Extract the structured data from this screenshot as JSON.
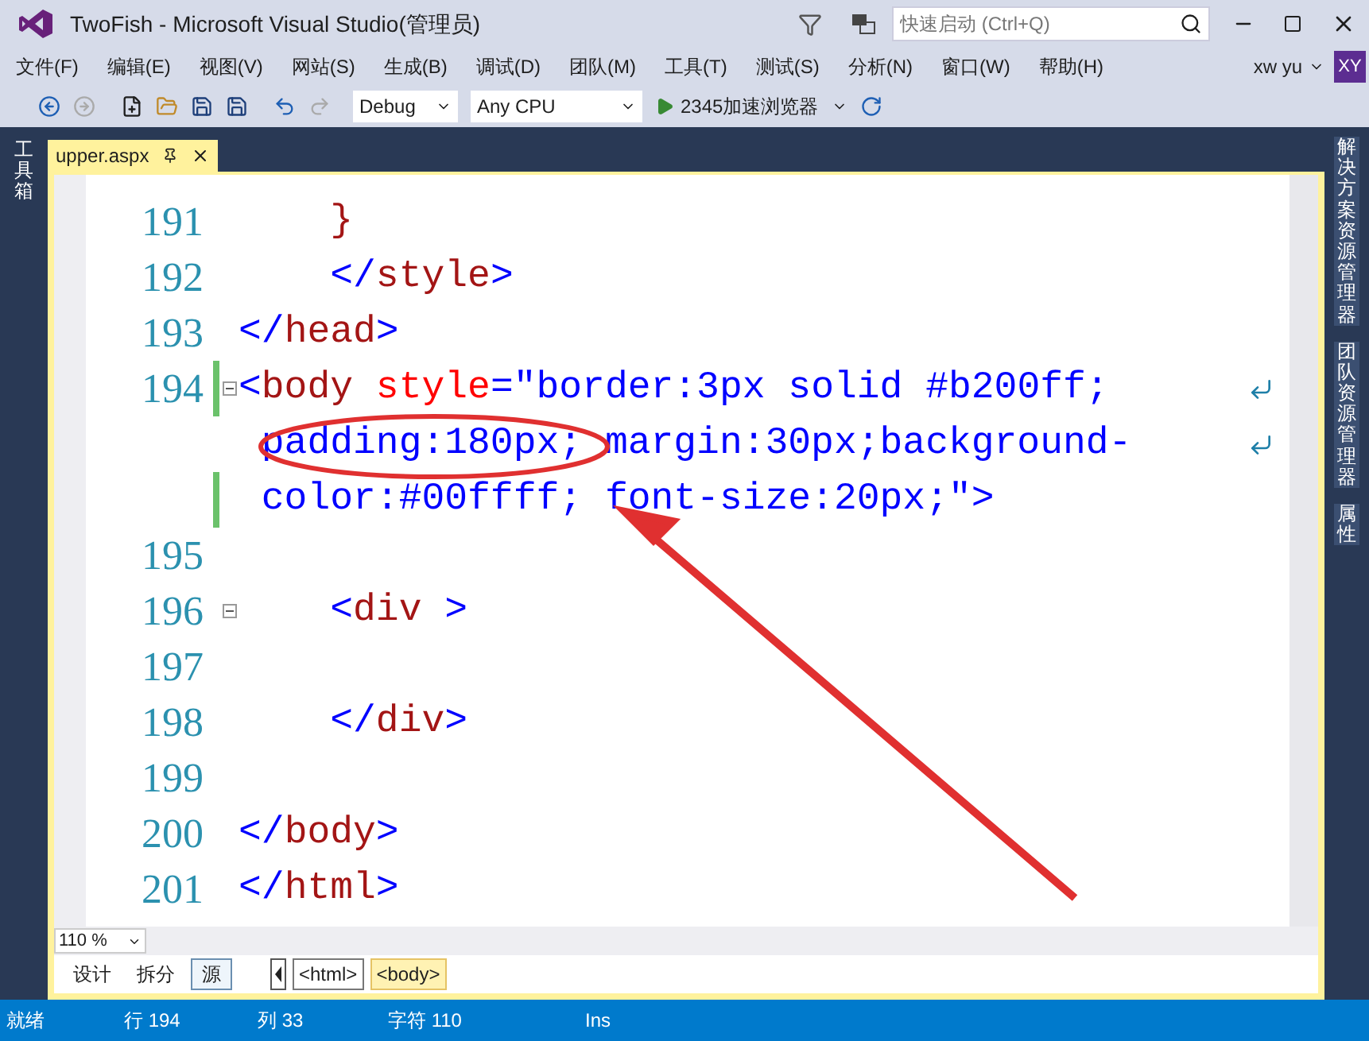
{
  "window": {
    "title": "TwoFish - Microsoft Visual Studio(管理员)",
    "quick_launch": {
      "placeholder": "快速启动 (Ctrl+Q)"
    }
  },
  "menu": [
    "文件(F)",
    "编辑(E)",
    "视图(V)",
    "网站(S)",
    "生成(B)",
    "调试(D)",
    "团队(M)",
    "工具(T)",
    "测试(S)",
    "分析(N)",
    "窗口(W)",
    "帮助(H)"
  ],
  "user": {
    "name": "xw yu",
    "initials": "XY"
  },
  "toolbar": {
    "configuration": "Debug",
    "platform": "Any CPU",
    "run_target": "2345加速浏览器"
  },
  "left_panel": "工具箱",
  "right_panels": [
    "解决方案资源管理器",
    "团队资源管理器",
    "属性"
  ],
  "tabs": [
    {
      "label": "upper.aspx",
      "selected": true
    }
  ],
  "editor": {
    "lines": [
      {
        "number": "191",
        "changed": false,
        "wrap": false,
        "fold": false,
        "tokens": [
          {
            "text": "    }",
            "kind": "tag"
          }
        ]
      },
      {
        "number": "192",
        "changed": false,
        "wrap": false,
        "fold": false,
        "tokens": [
          {
            "text": "    </",
            "kind": "bracket"
          },
          {
            "text": "style",
            "kind": "tag"
          },
          {
            "text": ">",
            "kind": "bracket"
          }
        ]
      },
      {
        "number": "193",
        "changed": false,
        "wrap": false,
        "fold": false,
        "tokens": [
          {
            "text": "</",
            "kind": "bracket"
          },
          {
            "text": "head",
            "kind": "tag"
          },
          {
            "text": ">",
            "kind": "bracket"
          }
        ]
      },
      {
        "number": "194",
        "changed": true,
        "wrap": true,
        "fold": true,
        "tokens": [
          {
            "text": "<",
            "kind": "bracket"
          },
          {
            "text": "body",
            "kind": "tag"
          },
          {
            "text": " style",
            "kind": "attr"
          },
          {
            "text": "=\"border:3px solid #b200ff;",
            "kind": "value"
          }
        ]
      },
      {
        "changed": false,
        "wrap": true,
        "fold": false,
        "tokens": [
          {
            "text": " padding:180px; margin:30px;background-",
            "kind": "value"
          }
        ]
      },
      {
        "changed": true,
        "wrap": false,
        "fold": false,
        "tokens": [
          {
            "text": " color:#00ffff; font-size:20px;\"",
            "kind": "value"
          },
          {
            "text": ">",
            "kind": "bracket"
          }
        ]
      },
      {
        "number": "195",
        "changed": false,
        "wrap": false,
        "fold": false
      },
      {
        "number": "196",
        "changed": false,
        "wrap": false,
        "fold": true,
        "tokens": [
          {
            "text": "    <",
            "kind": "bracket"
          },
          {
            "text": "div",
            "kind": "tag"
          },
          {
            "text": " >",
            "kind": "bracket"
          }
        ]
      },
      {
        "number": "197",
        "changed": false,
        "wrap": false,
        "fold": false
      },
      {
        "number": "198",
        "changed": false,
        "wrap": false,
        "fold": false,
        "tokens": [
          {
            "text": "    </",
            "kind": "bracket"
          },
          {
            "text": "div",
            "kind": "tag"
          },
          {
            "text": ">",
            "kind": "bracket"
          }
        ]
      },
      {
        "number": "199",
        "changed": false,
        "wrap": false,
        "fold": false
      },
      {
        "number": "200",
        "changed": false,
        "wrap": false,
        "fold": false,
        "tokens": [
          {
            "text": "</",
            "kind": "bracket"
          },
          {
            "text": "body",
            "kind": "tag"
          },
          {
            "text": ">",
            "kind": "bracket"
          }
        ]
      },
      {
        "number": "201",
        "changed": false,
        "wrap": false,
        "fold": false,
        "tokens": [
          {
            "text": "</",
            "kind": "bracket"
          },
          {
            "text": "html",
            "kind": "tag"
          },
          {
            "text": ">",
            "kind": "bracket"
          }
        ]
      }
    ]
  },
  "zoom": "110 %",
  "views": [
    {
      "label": "设计",
      "selected": false
    },
    {
      "label": "拆分",
      "selected": false
    },
    {
      "label": "源",
      "selected": true
    }
  ],
  "breadcrumb": [
    {
      "label": "<html>",
      "selected": false
    },
    {
      "label": "<body>",
      "selected": true
    }
  ],
  "status_bar": [
    "就绪",
    "行 194",
    "列 33",
    "字符 110",
    "Ins"
  ]
}
